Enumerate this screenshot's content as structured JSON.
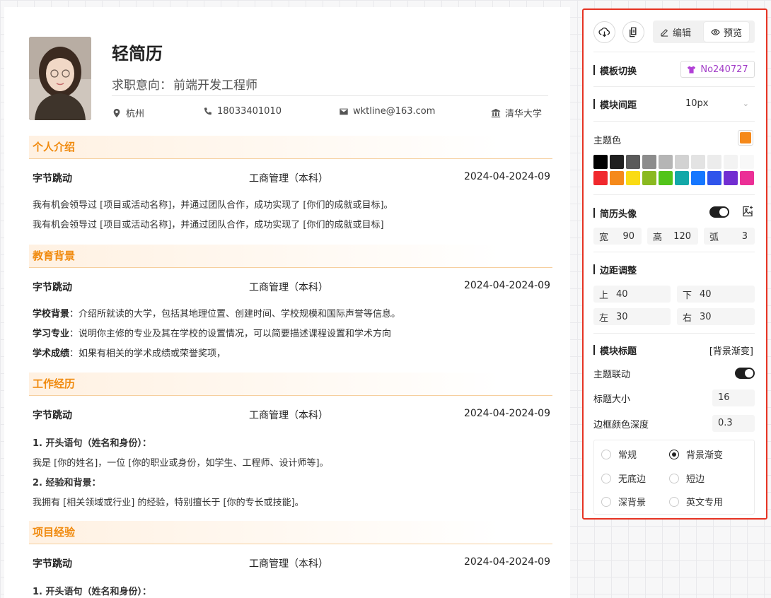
{
  "resume": {
    "name": "轻简历",
    "intent_label": "求职意向：",
    "intent_value": "前端开发工程师",
    "info": {
      "city": "杭州",
      "phone": "18033401010",
      "email": "wktline@163.com",
      "school": "清华大学"
    },
    "sections": [
      {
        "title": "个人介绍",
        "row": {
          "org": "字节跳动",
          "major": "工商管理（本科）",
          "date": "2024-04-2024-09"
        },
        "lines": [
          "我有机会领导过 [项目或活动名称]，并通过团队合作，成功实现了 [你们的成就或目标]。",
          "我有机会领导过 [项目或活动名称]，并通过团队合作，成功实现了 [你们的成就或目标]"
        ]
      },
      {
        "title": "教育背景",
        "row": {
          "org": "字节跳动",
          "major": "工商管理（本科）",
          "date": "2024-04-2024-09"
        },
        "items": [
          {
            "k": "学校背景",
            "v": "：介绍所就读的大学，包括其地理位置、创建时间、学校规模和国际声誉等信息。"
          },
          {
            "k": "学习专业",
            "v": "：说明你主修的专业及其在学校的设置情况，可以简要描述课程设置和学术方向"
          },
          {
            "k": "学术成绩",
            "v": "：如果有相关的学术成绩或荣誉奖项，"
          }
        ]
      },
      {
        "title": "工作经历",
        "row": {
          "org": "字节跳动",
          "major": "工商管理（本科）",
          "date": "2024-04-2024-09"
        },
        "lines": [
          "1. 开头语句（姓名和身份）：",
          "我是 [你的姓名]，一位 [你的职业或身份，如学生、工程师、设计师等]。",
          "2. 经验和背景：",
          "我拥有 [相关领域或行业] 的经验，特别擅长于 [你的专长或技能]。"
        ]
      },
      {
        "title": "项目经验",
        "row": {
          "org": "字节跳动",
          "major": "工商管理（本科）",
          "date": "2024-04-2024-09"
        },
        "lines": [
          "1. 开头语句（姓名和身份）："
        ]
      }
    ]
  },
  "panel": {
    "edit_label": "编辑",
    "preview_label": "预览",
    "template_label": "模板切换",
    "template_value": "No240727",
    "spacing_label": "模块间距",
    "spacing_value": "10px",
    "theme_label": "主题色",
    "theme_color": "#f5891a",
    "palette_row1": [
      "#000000",
      "#1f1f1f",
      "#5a5a5a",
      "#8c8c8c",
      "#b5b5b5",
      "#d2d2d2",
      "#e3e3e3",
      "#ececec",
      "#f3f3f3",
      "#f8f8f8"
    ],
    "palette_row2": [
      "#f0282d",
      "#f5891a",
      "#fadb14",
      "#8ab920",
      "#52c41a",
      "#13a8a8",
      "#1677ff",
      "#2f54eb",
      "#722ed1",
      "#eb2f96"
    ],
    "avatar_label": "简历头像",
    "avatar_w_key": "宽",
    "avatar_w": "90",
    "avatar_h_key": "高",
    "avatar_h": "120",
    "avatar_r_key": "弧",
    "avatar_r": "3",
    "margin_label": "边距调整",
    "margin_top_key": "上",
    "margin_top": "40",
    "margin_bottom_key": "下",
    "margin_bottom": "40",
    "margin_left_key": "左",
    "margin_left": "30",
    "margin_right_key": "右",
    "margin_right": "30",
    "module_title_label": "模块标题",
    "module_title_value": "[背景渐变]",
    "theme_link_label": "主题联动",
    "title_size_label": "标题大小",
    "title_size_value": "16",
    "border_depth_label": "边框颜色深度",
    "border_depth_value": "0.3",
    "radios": [
      "常规",
      "背景渐变",
      "无底边",
      "短边",
      "深背景",
      "英文专用"
    ],
    "selected_radio": "背景渐变"
  }
}
